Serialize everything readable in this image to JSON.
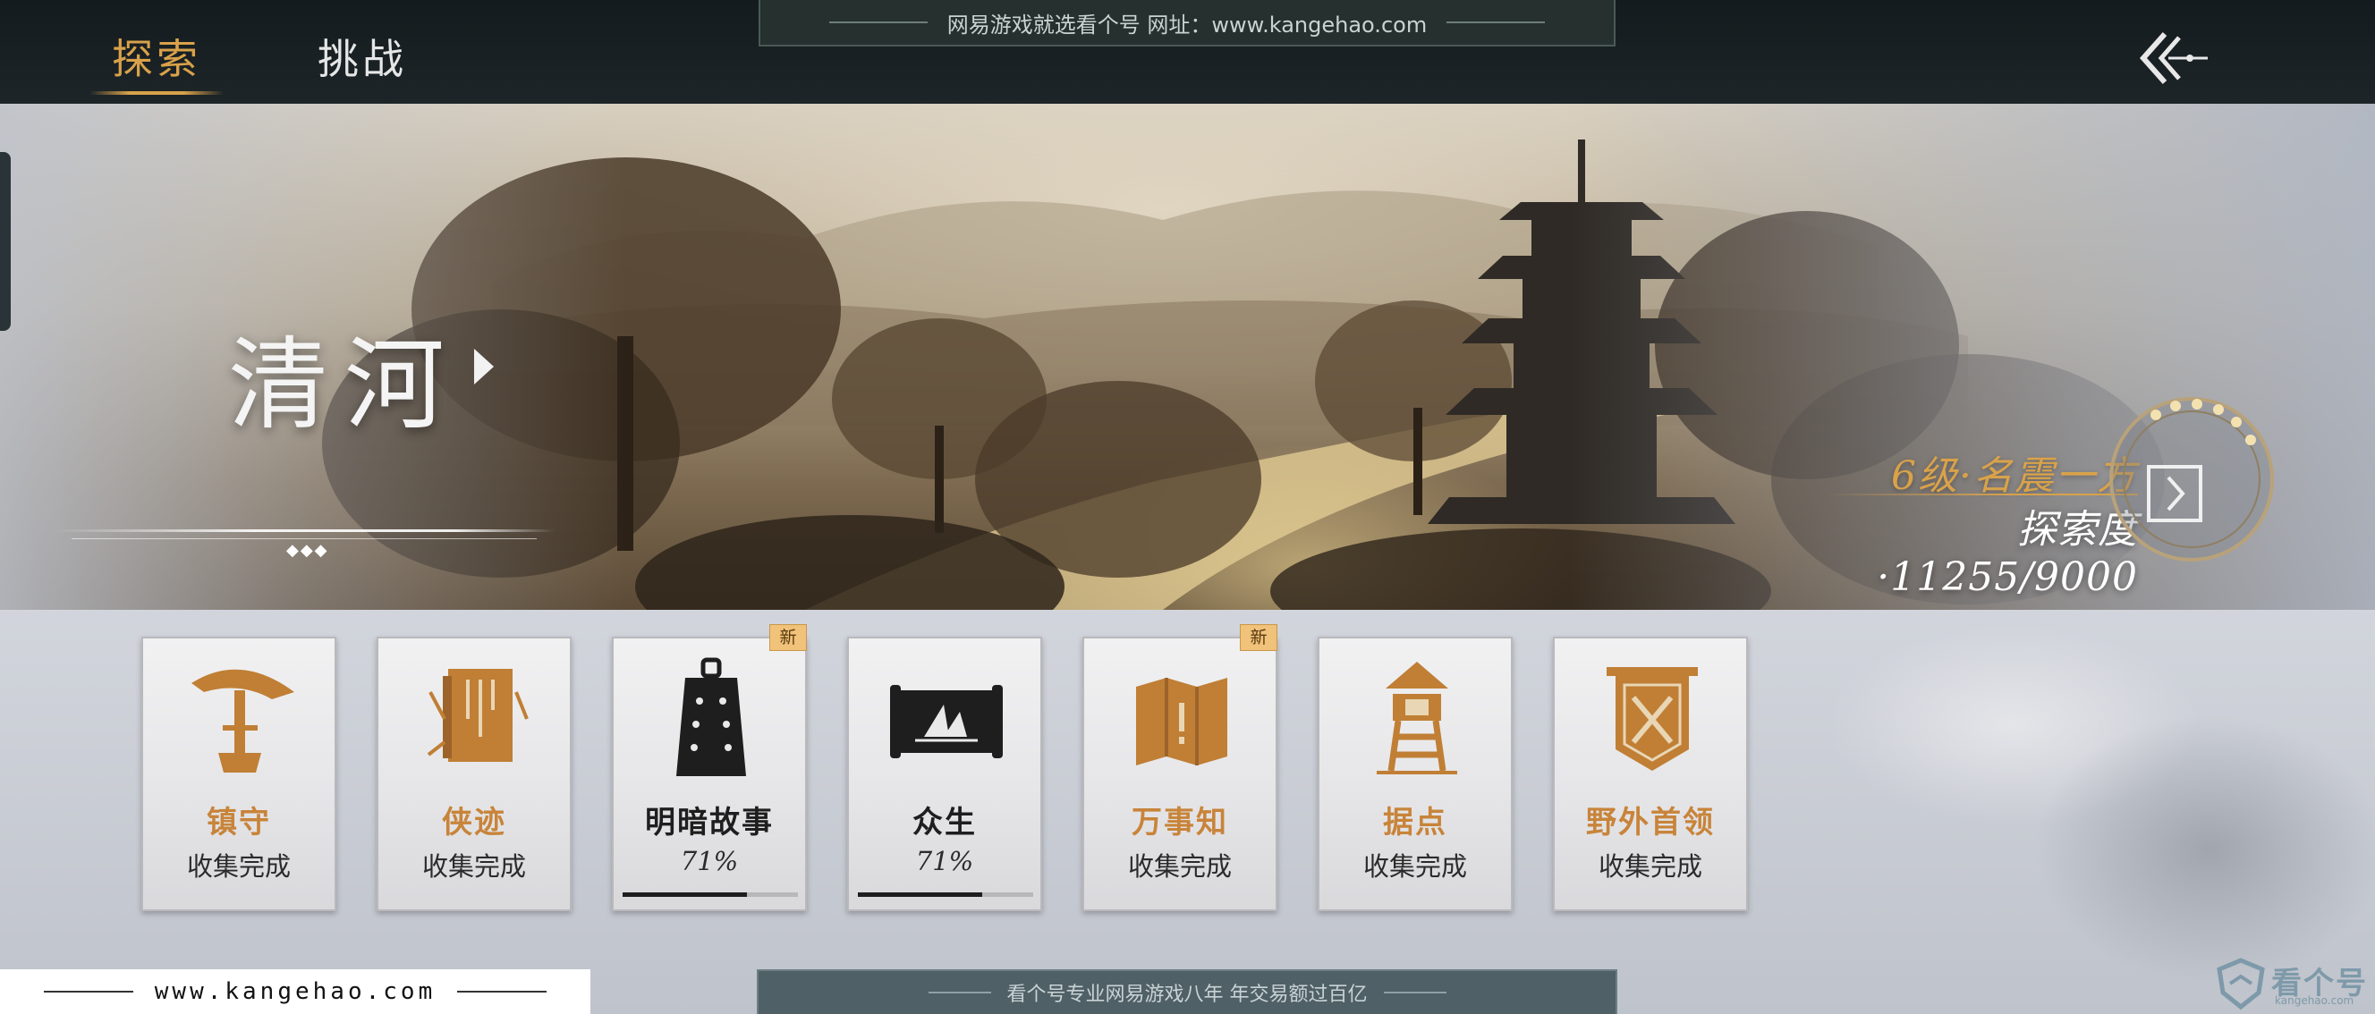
{
  "header": {
    "tabs": [
      {
        "label": "探索",
        "active": true
      },
      {
        "label": "挑战",
        "active": false
      }
    ],
    "watermark": "网易游戏就选看个号    网址：www.kangehao.com"
  },
  "region": {
    "name": "清河",
    "rank": "6级·名震一方",
    "progress": "探索度·11255/9000"
  },
  "cards": [
    {
      "title": "镇守",
      "status": "收集完成",
      "icon": "hat-icon",
      "new": false
    },
    {
      "title": "侠迹",
      "status": "收集完成",
      "icon": "book-icon",
      "new": false
    },
    {
      "title": "明暗故事",
      "status": "71%",
      "progress": 0.71,
      "icon": "bell-icon",
      "new": true,
      "badge": "新"
    },
    {
      "title": "众生",
      "status": "71%",
      "progress": 0.71,
      "icon": "scroll-icon",
      "new": false
    },
    {
      "title": "万事知",
      "status": "收集完成",
      "icon": "map-icon",
      "new": true,
      "badge": "新"
    },
    {
      "title": "据点",
      "status": "收集完成",
      "icon": "watchtower-icon",
      "new": false
    },
    {
      "title": "野外首领",
      "status": "收集完成",
      "icon": "banner-swords-icon",
      "new": false
    }
  ],
  "footer": {
    "site": "www.kangehao.com",
    "watermark": "看个号专业网易游戏八年  年交易额过百亿",
    "brand": "看个号",
    "brand_url": "kangehao.com"
  },
  "colors": {
    "accent_gold": "#d9a24a",
    "card_title_gold": "#c8843a",
    "topbar": "#141b1e"
  }
}
